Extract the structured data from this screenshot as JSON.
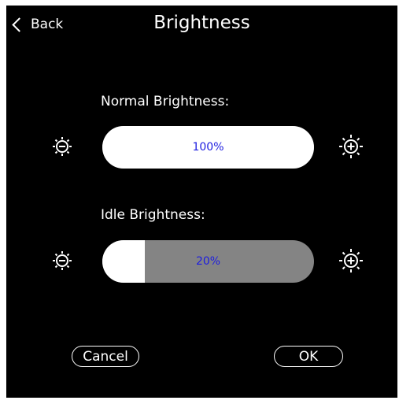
{
  "header": {
    "back_label": "Back",
    "title": "Brightness"
  },
  "normal": {
    "label": "Normal Brightness:",
    "value_text": "100%",
    "level": 1.0
  },
  "idle": {
    "label": "Idle Brightness:",
    "value_text": "20%",
    "level": 0.2
  },
  "footer": {
    "cancel_label": "Cancel",
    "ok_label": "OK"
  },
  "icons": {
    "decrease": "brightness-decrease-icon",
    "increase": "brightness-increase-icon"
  },
  "colors": {
    "background": "#000000",
    "slider_track": "#848484",
    "slider_fill": "#ffffff",
    "value_text": "#1d1de0"
  }
}
